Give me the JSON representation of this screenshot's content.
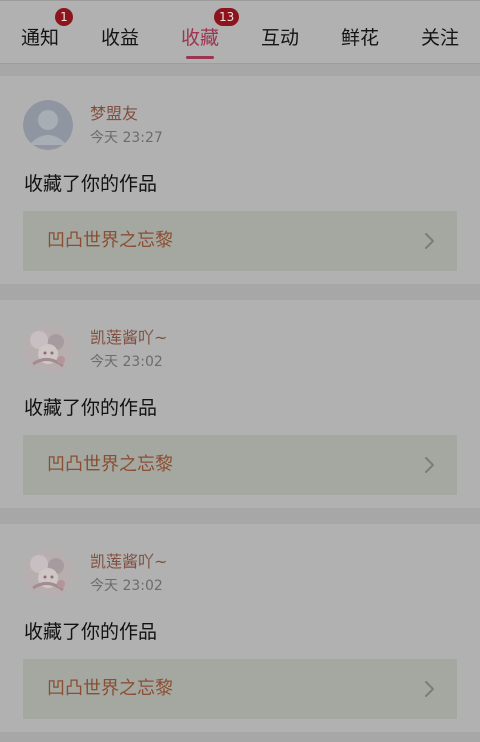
{
  "tabs": [
    {
      "label": "通知",
      "badge": "1"
    },
    {
      "label": "收益",
      "badge": ""
    },
    {
      "label": "收藏",
      "badge": "13",
      "active": true
    },
    {
      "label": "互动",
      "badge": ""
    },
    {
      "label": "鲜花",
      "badge": ""
    },
    {
      "label": "关注",
      "badge": ""
    }
  ],
  "notifications": [
    {
      "username": "梦盟友",
      "time": "今天 23:27",
      "message": "收藏了你的作品",
      "work_title": "凹凸世界之忘黎",
      "avatar": "default-avatar-icon"
    },
    {
      "username": "凯莲酱吖~",
      "time": "今天 23:02",
      "message": "收藏了你的作品",
      "work_title": "凹凸世界之忘黎",
      "avatar": "anime-avatar"
    },
    {
      "username": "凯莲酱吖~",
      "time": "今天 23:02",
      "message": "收藏了你的作品",
      "work_title": "凹凸世界之忘黎",
      "avatar": "anime-avatar"
    }
  ],
  "colors": {
    "accent": "#9c3550",
    "badge": "#8c141c",
    "username": "#7f5040",
    "work_title": "#8a4e33"
  }
}
